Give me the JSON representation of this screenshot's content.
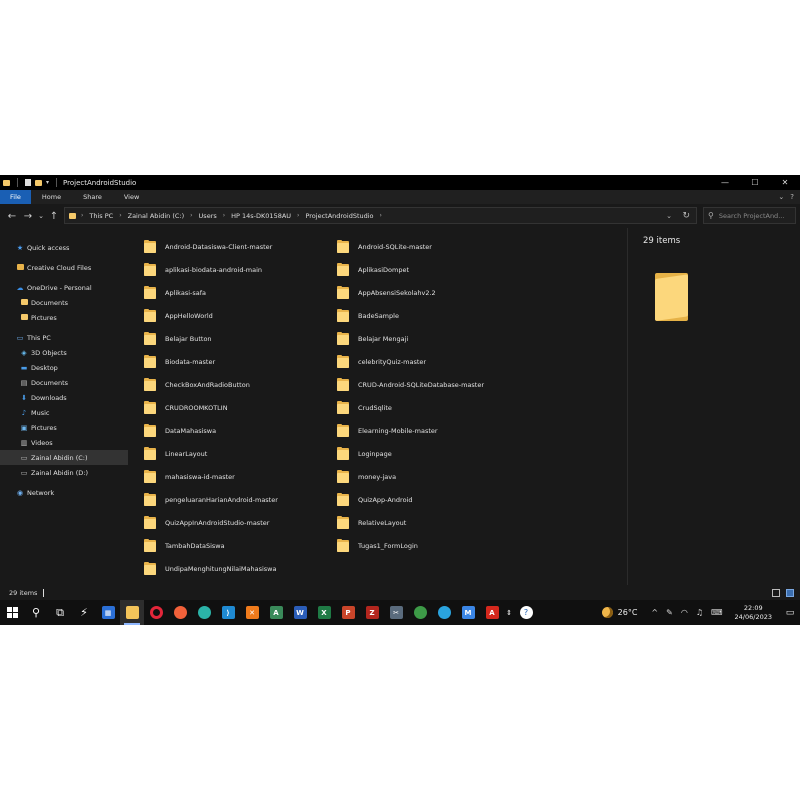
{
  "window": {
    "title": "ProjectAndroidStudio",
    "controls": [
      "—",
      "☐",
      "✕"
    ]
  },
  "ribbon": {
    "tabs": [
      "File",
      "Home",
      "Share",
      "View"
    ]
  },
  "address": {
    "crumbs": [
      "This PC",
      "Zainal Abidin (C:)",
      "Users",
      "HP 14s-DK0158AU",
      "ProjectAndroidStudio"
    ]
  },
  "search": {
    "placeholder": "Search ProjectAnd..."
  },
  "nav": {
    "items": [
      {
        "label": "Quick access",
        "icon": "star-icon",
        "level": 0
      },
      {
        "label": "Creative Cloud Files",
        "icon": "cloud-files-icon",
        "level": 0
      },
      {
        "label": "OneDrive - Personal",
        "icon": "onedrive-icon",
        "level": 0
      },
      {
        "label": "Documents",
        "icon": "folder-icon",
        "level": 1
      },
      {
        "label": "Pictures",
        "icon": "folder-icon",
        "level": 1
      },
      {
        "label": "This PC",
        "icon": "computer-icon",
        "level": 0
      },
      {
        "label": "3D Objects",
        "icon": "cube-icon",
        "level": 1
      },
      {
        "label": "Desktop",
        "icon": "desktop-icon",
        "level": 1
      },
      {
        "label": "Documents",
        "icon": "document-icon",
        "level": 1
      },
      {
        "label": "Downloads",
        "icon": "download-icon",
        "level": 1
      },
      {
        "label": "Music",
        "icon": "music-icon",
        "level": 1
      },
      {
        "label": "Pictures",
        "icon": "picture-icon",
        "level": 1
      },
      {
        "label": "Videos",
        "icon": "video-icon",
        "level": 1
      },
      {
        "label": "Zainal Abidin (C:)",
        "icon": "drive-icon",
        "level": 1
      },
      {
        "label": "Zainal Abidin (D:)",
        "icon": "drive-icon",
        "level": 1
      },
      {
        "label": "Network",
        "icon": "network-icon",
        "level": 0
      }
    ],
    "selected": "Zainal Abidin (C:)"
  },
  "files": {
    "col1": [
      "Android-Datasiswa-Client-master",
      "aplikasi-biodata-android-main",
      "Aplikasi-safa",
      "AppHelloWorld",
      "Belajar Button",
      "Biodata-master",
      "CheckBoxAndRadioButton",
      "CRUDROOMKOTLIN",
      "DataMahasiswa",
      "LinearLayout",
      "mahasiswa-id-master",
      "pengeluaranHarianAndroid-master",
      "QuizAppInAndroidStudio-master",
      "TambahDataSiswa",
      "UndipaMenghitungNilaiMahasiswa"
    ],
    "col2": [
      "Android-SQLite-master",
      "AplikasiDompet",
      "AppAbsensiSekolahv2.2",
      "BadeSample",
      "Belajar Mengaji",
      "celebrityQuiz-master",
      "CRUD-Android-SQLiteDatabase-master",
      "CrudSqlite",
      "Elearning-Mobile-master",
      "Loginpage",
      "money-java",
      "QuizApp-Android",
      "RelativeLayout",
      "Tugas1_FormLogin"
    ]
  },
  "details": {
    "count": "29 items"
  },
  "status": {
    "count": "29 items"
  },
  "taskbar": {
    "weather": "26°C",
    "time": "22:09",
    "date": "24/06/2023",
    "colors": {
      "accent": "#1a5fb4",
      "folder": "#fcd77c"
    }
  }
}
